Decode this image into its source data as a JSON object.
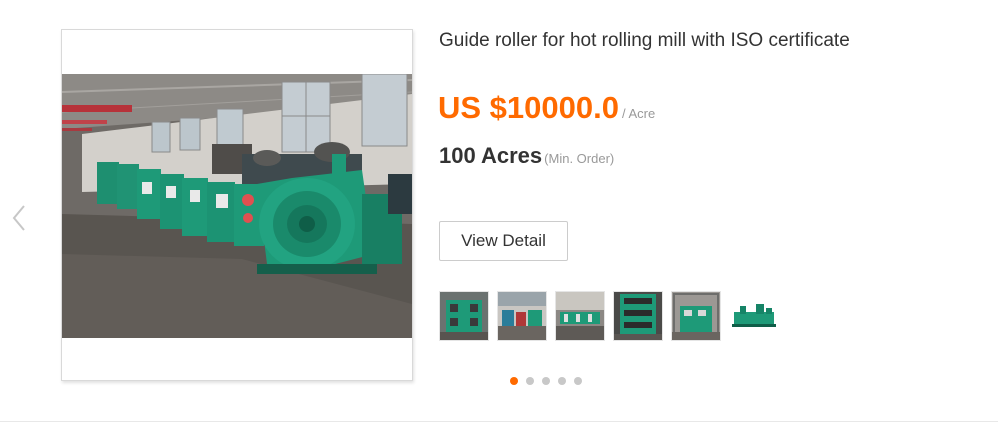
{
  "product": {
    "title": "Guide roller for hot rolling mill with ISO certificate",
    "price": "US $10000.0",
    "price_unit": "/ Acre",
    "moq": "100 Acres",
    "moq_note": "(Min. Order)",
    "view_detail_label": "View Detail"
  },
  "gallery": {
    "thumbnail_count": 6,
    "pagination_dots": 5,
    "active_dot": 1
  },
  "icons": {
    "prev": "chevron-left-icon"
  },
  "colors": {
    "accent": "#ff6a00",
    "machine_green": "#1e9a78",
    "dot_inactive": "#c8c8c8"
  }
}
